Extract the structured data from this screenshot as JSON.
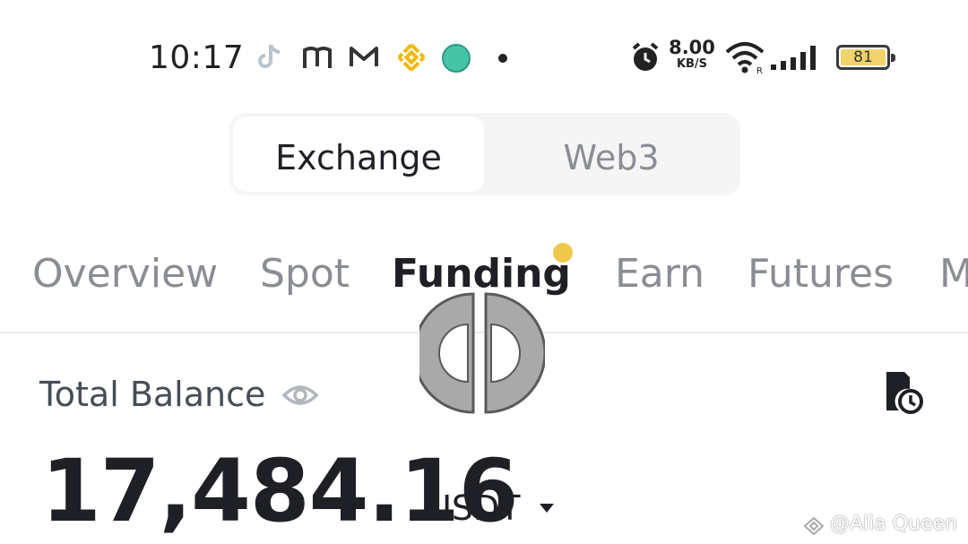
{
  "status_bar": {
    "time": "10:17",
    "notification_icons": [
      "tiktok-icon",
      "app-icon",
      "gmail-icon",
      "binance-icon",
      "green-app-icon",
      "dot-icon"
    ],
    "net_speed_value": "8.00",
    "net_speed_unit": "KB/S",
    "battery_level": "81",
    "icons": [
      "alarm-icon",
      "wifi-icon",
      "signal-icon",
      "battery-icon"
    ]
  },
  "switcher": {
    "options": [
      "Exchange",
      "Web3"
    ],
    "selected": "Exchange"
  },
  "tabs": {
    "items": [
      "Overview",
      "Spot",
      "Funding",
      "Earn",
      "Futures",
      "M"
    ],
    "active": "Funding"
  },
  "balance": {
    "label": "Total Balance",
    "value": "17,484.16",
    "unit": "USDT"
  },
  "watermark": {
    "text": "@Alia Queen"
  },
  "colors": {
    "accent_yellow": "#f0c94a",
    "text_primary": "#1e2026",
    "text_muted": "#8a8d93",
    "segment_bg": "#f5f5f5"
  }
}
